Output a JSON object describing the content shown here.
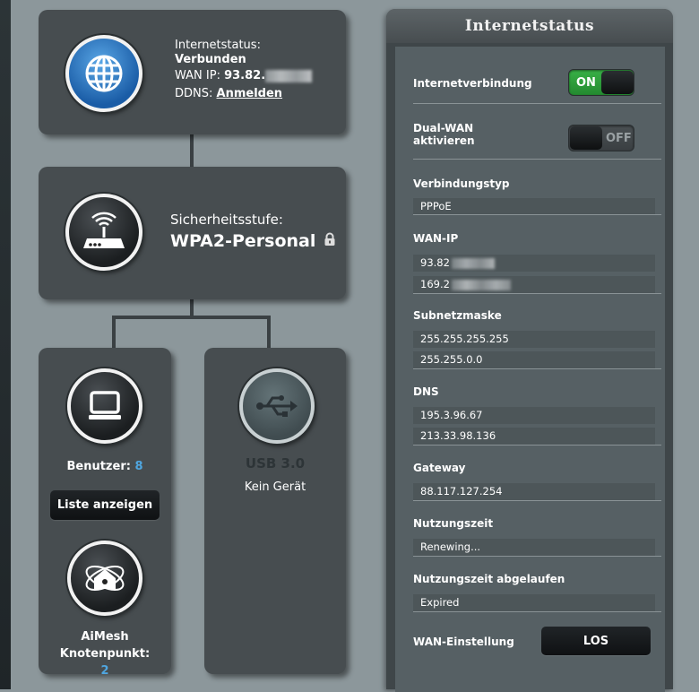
{
  "internet": {
    "status_label": "Internetstatus:",
    "status_value": "Verbunden",
    "wan_ip_label": "WAN IP:",
    "wan_ip_value": "93.82.",
    "ddns_label": "DDNS:",
    "ddns_link": "Anmelden"
  },
  "security": {
    "label": "Sicherheitsstufe:",
    "value": "WPA2-Personal"
  },
  "clients": {
    "label": "Benutzer:",
    "count": "8",
    "list_button": "Liste anzeigen"
  },
  "usb": {
    "label": "USB 3.0",
    "status": "Kein Gerät"
  },
  "aimesh": {
    "label": "AiMesh Knotenpunkt:",
    "count": "2"
  },
  "panel": {
    "title": "Internetstatus",
    "internet_connection_label": "Internetverbindung",
    "internet_connection_state": "ON",
    "dual_wan_label_1": "Dual-WAN",
    "dual_wan_label_2": "aktivieren",
    "dual_wan_state": "OFF",
    "connection_type_label": "Verbindungstyp",
    "connection_type_value": "PPPoE",
    "wan_ip_label": "WAN-IP",
    "wan_ip_1": "93.82",
    "wan_ip_2": "169.2",
    "subnet_label": "Subnetzmaske",
    "subnet_1": "255.255.255.255",
    "subnet_2": "255.255.0.0",
    "dns_label": "DNS",
    "dns_1": "195.3.96.67",
    "dns_2": "213.33.98.136",
    "gateway_label": "Gateway",
    "gateway_value": "88.117.127.254",
    "lease_label": "Nutzungszeit",
    "lease_value": "Renewing...",
    "lease_expired_label": "Nutzungszeit abgelaufen",
    "lease_expired_value": "Expired",
    "wan_setting_label": "WAN-Einstellung",
    "wan_setting_button": "LOS"
  },
  "colors": {
    "accent_blue": "#5aa7e6",
    "toggle_on": "#2f9d3a",
    "count_blue": "#4fa6e0"
  }
}
